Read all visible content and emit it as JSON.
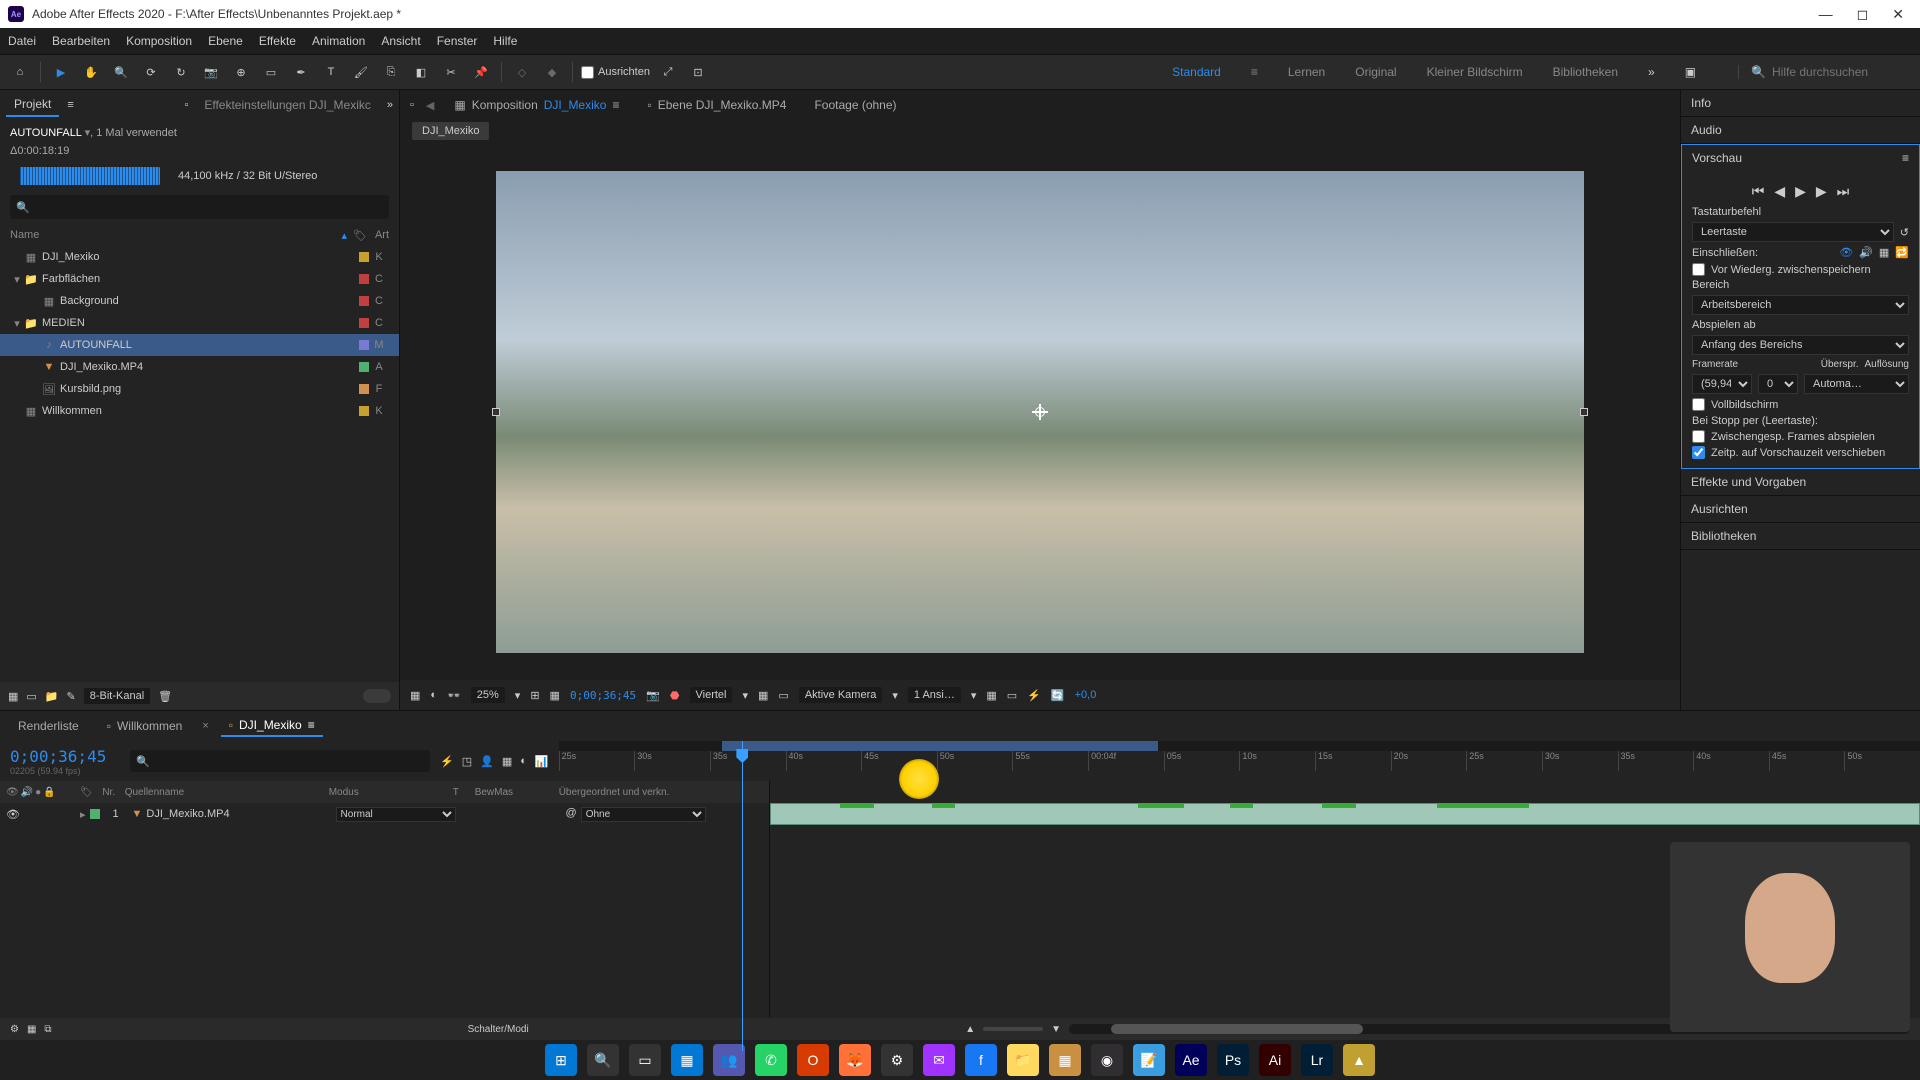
{
  "title": "Adobe After Effects 2020 - F:\\After Effects\\Unbenanntes Projekt.aep *",
  "menu": [
    "Datei",
    "Bearbeiten",
    "Komposition",
    "Ebene",
    "Effekte",
    "Animation",
    "Ansicht",
    "Fenster",
    "Hilfe"
  ],
  "toolbar": {
    "ausrichten": "Ausrichten"
  },
  "workspaces": {
    "items": [
      "Standard",
      "Lernen",
      "Original",
      "Kleiner Bildschirm",
      "Bibliotheken"
    ],
    "active": "Standard"
  },
  "help_search_placeholder": "Hilfe durchsuchen",
  "project": {
    "tab_projekt": "Projekt",
    "tab_effekt": "Effekteinstellungen DJI_Mexikc",
    "asset_name": "AUTOUNFALL",
    "asset_used": ", 1 Mal verwendet",
    "duration": "Δ0:00:18:19",
    "audio_spec": "44,100 kHz / 32 Bit U/Stereo",
    "col_name": "Name",
    "col_art": "Art",
    "bit_depth": "8-Bit-Kanal",
    "items": [
      {
        "name": "DJI_Mexiko",
        "type": "comp",
        "art": "K",
        "color": "#c8a030",
        "indent": 0,
        "tw": ""
      },
      {
        "name": "Farbflächen",
        "type": "folder",
        "art": "C",
        "color": "#c04040",
        "indent": 0,
        "tw": "▾"
      },
      {
        "name": "Background",
        "type": "solid",
        "art": "C",
        "color": "#c04040",
        "indent": 1,
        "tw": ""
      },
      {
        "name": "MEDIEN",
        "type": "folder",
        "art": "C",
        "color": "#c04040",
        "indent": 0,
        "tw": "▾"
      },
      {
        "name": "AUTOUNFALL",
        "type": "audio",
        "art": "M",
        "color": "#7a7ad0",
        "indent": 1,
        "tw": "",
        "sel": true
      },
      {
        "name": "DJI_Mexiko.MP4",
        "type": "video",
        "art": "A",
        "color": "#50b070",
        "indent": 1,
        "tw": ""
      },
      {
        "name": "Kursbild.png",
        "type": "image",
        "art": "F",
        "color": "#d09050",
        "indent": 1,
        "tw": ""
      },
      {
        "name": "Willkommen",
        "type": "comp",
        "art": "K",
        "color": "#c8a030",
        "indent": 0,
        "tw": ""
      }
    ]
  },
  "comp": {
    "tab_komp": "Komposition",
    "tab_komp_name": "DJI_Mexiko",
    "tab_ebene": "Ebene DJI_Mexiko.MP4",
    "tab_footage": "Footage (ohne)",
    "flow": "DJI_Mexiko"
  },
  "viewer_foot": {
    "zoom": "25%",
    "timecode": "0;00;36;45",
    "res": "Viertel",
    "camera": "Aktive Kamera",
    "views": "1 Ansi…",
    "exposure": "+0,0"
  },
  "right": {
    "info": "Info",
    "audio": "Audio",
    "vorschau": "Vorschau",
    "tastatur": "Tastaturbefehl",
    "leertaste": "Leertaste",
    "einsch": "Einschließen:",
    "vor_wiederg": "Vor Wiederg. zwischenspeichern",
    "bereich": "Bereich",
    "arbeitsbereich": "Arbeitsbereich",
    "abspielen": "Abspielen ab",
    "anfang": "Anfang des Bereichs",
    "framerate": "Framerate",
    "ueberspr": "Überspr.",
    "aufl": "Auflösung",
    "fr_val": "(59,94)",
    "skip_val": "0",
    "aufl_val": "Automa…",
    "vollbild": "Vollbildschirm",
    "stopp": "Bei Stopp per (Leertaste):",
    "zw_frames": "Zwischengesp. Frames abspielen",
    "zeitp": "Zeitp. auf Vorschauzeit verschieben",
    "effekte": "Effekte und Vorgaben",
    "ausrichten": "Ausrichten",
    "bibliotheken": "Bibliotheken"
  },
  "timeline": {
    "tab_render": "Renderliste",
    "tab_welcome": "Willkommen",
    "tab_comp": "DJI_Mexiko",
    "timecode": "0;00;36;45",
    "frame_info": "02205 (59.94 fps)",
    "col_nr": "Nr.",
    "col_name": "Quellenname",
    "col_modus": "Modus",
    "col_t": "T",
    "col_bewmas": "BewMas",
    "col_parent": "Übergeordnet und verkn.",
    "layer_nr": "1",
    "layer_name": "DJI_Mexiko.MP4",
    "mode_normal": "Normal",
    "parent_ohne": "Ohne",
    "ticks": [
      "25s",
      "30s",
      "35s",
      "40s",
      "45s",
      "50s",
      "55s",
      "00:04f",
      "05s",
      "10s",
      "15s",
      "20s",
      "25s",
      "30s",
      "35s",
      "40s",
      "45s",
      "50s"
    ],
    "schalter": "Schalter/Modi"
  },
  "taskbar": {
    "icons": [
      {
        "name": "windows-start",
        "bg": "#0078d4",
        "txt": "⊞"
      },
      {
        "name": "search",
        "bg": "#333",
        "txt": "🔍"
      },
      {
        "name": "task-view",
        "bg": "#333",
        "txt": "▭"
      },
      {
        "name": "widgets",
        "bg": "#0078d4",
        "txt": "▦"
      },
      {
        "name": "teams",
        "bg": "#5558af",
        "txt": "👥"
      },
      {
        "name": "whatsapp",
        "bg": "#25d366",
        "txt": "✆"
      },
      {
        "name": "office",
        "bg": "#d83b01",
        "txt": "O"
      },
      {
        "name": "firefox",
        "bg": "#ff7139",
        "txt": "🦊"
      },
      {
        "name": "app1",
        "bg": "#333",
        "txt": "⚙"
      },
      {
        "name": "messenger",
        "bg": "#a033ff",
        "txt": "✉"
      },
      {
        "name": "facebook",
        "bg": "#1877f2",
        "txt": "f"
      },
      {
        "name": "explorer",
        "bg": "#ffd860",
        "txt": "📁"
      },
      {
        "name": "app2",
        "bg": "#c89040",
        "txt": "▦"
      },
      {
        "name": "obs",
        "bg": "#302e31",
        "txt": "◉"
      },
      {
        "name": "notepad",
        "bg": "#3a9de0",
        "txt": "📝"
      },
      {
        "name": "after-effects",
        "bg": "#00005b",
        "txt": "Ae"
      },
      {
        "name": "photoshop",
        "bg": "#001e36",
        "txt": "Ps"
      },
      {
        "name": "illustrator",
        "bg": "#330000",
        "txt": "Ai"
      },
      {
        "name": "lightroom",
        "bg": "#001e36",
        "txt": "Lr"
      },
      {
        "name": "app3",
        "bg": "#c0a030",
        "txt": "▲"
      }
    ]
  }
}
